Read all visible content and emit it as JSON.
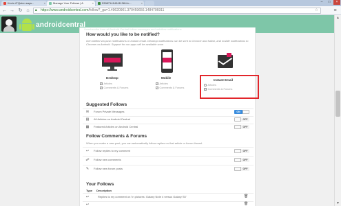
{
  "browser": {
    "tabs": [
      {
        "label": "Kevin O'Quinn says..."
      },
      {
        "label": "Manage Your Follows | A"
      },
      {
        "label": "539871414041138-Kn..."
      }
    ],
    "url_secure": "https://www.androidcentral.com",
    "url_rest": "/follow?_ga=1.49620901.370459656.1484706911"
  },
  "site": {
    "logo": "androidcentral"
  },
  "notify": {
    "ghost_text": "Unsubscribe from all Android Central follow messages and unfollow notifications",
    "title": "How would you like to be notified?",
    "description": "Get notified via push notifications or instant email. Desktop notifications can be sent to Chrome and Safari, and mobile notifications to Chrome on Android. Support for our apps will be available soon",
    "options": [
      {
        "title": "Desktop",
        "articles": "Articles",
        "comments": "Comments & Forums"
      },
      {
        "title": "Mobile",
        "articles": "Articles",
        "comments": "Comments & Forums"
      },
      {
        "title": "Instant Email",
        "articles": "Articles",
        "comments": "Comments & Forums"
      }
    ]
  },
  "suggested": {
    "title": "Suggested Follows",
    "rows": [
      {
        "label": "Forum Private Messages",
        "state": "ON"
      },
      {
        "label": "All Articles on Android Central",
        "state": "OFF"
      },
      {
        "label": "Featured Articles on Android Central",
        "state": "OFF"
      }
    ]
  },
  "comments_forums": {
    "title": "Follow Comments & Forums",
    "description": "When you make a new post, you can automatically follow replies on that article or forum thread.",
    "rows": [
      {
        "label": "Follow replies to my comment",
        "state": "OFF"
      },
      {
        "label": "Follow new comments",
        "state": "OFF"
      },
      {
        "label": "Follow new forum posts",
        "state": "OFF"
      }
    ]
  },
  "your_follows": {
    "title": "Your Follows",
    "col_type": "Type",
    "col_desc": "Description",
    "rows": [
      {
        "label": "Replies to my comment on 'In pictures: Galaxy Note 4 versus Galaxy S5'"
      }
    ]
  },
  "colors": {
    "accent": "#7ec6a8",
    "toggle_on": "#3a8dde",
    "highlight": "#e2262b",
    "icon_bar": "#d9185a"
  }
}
